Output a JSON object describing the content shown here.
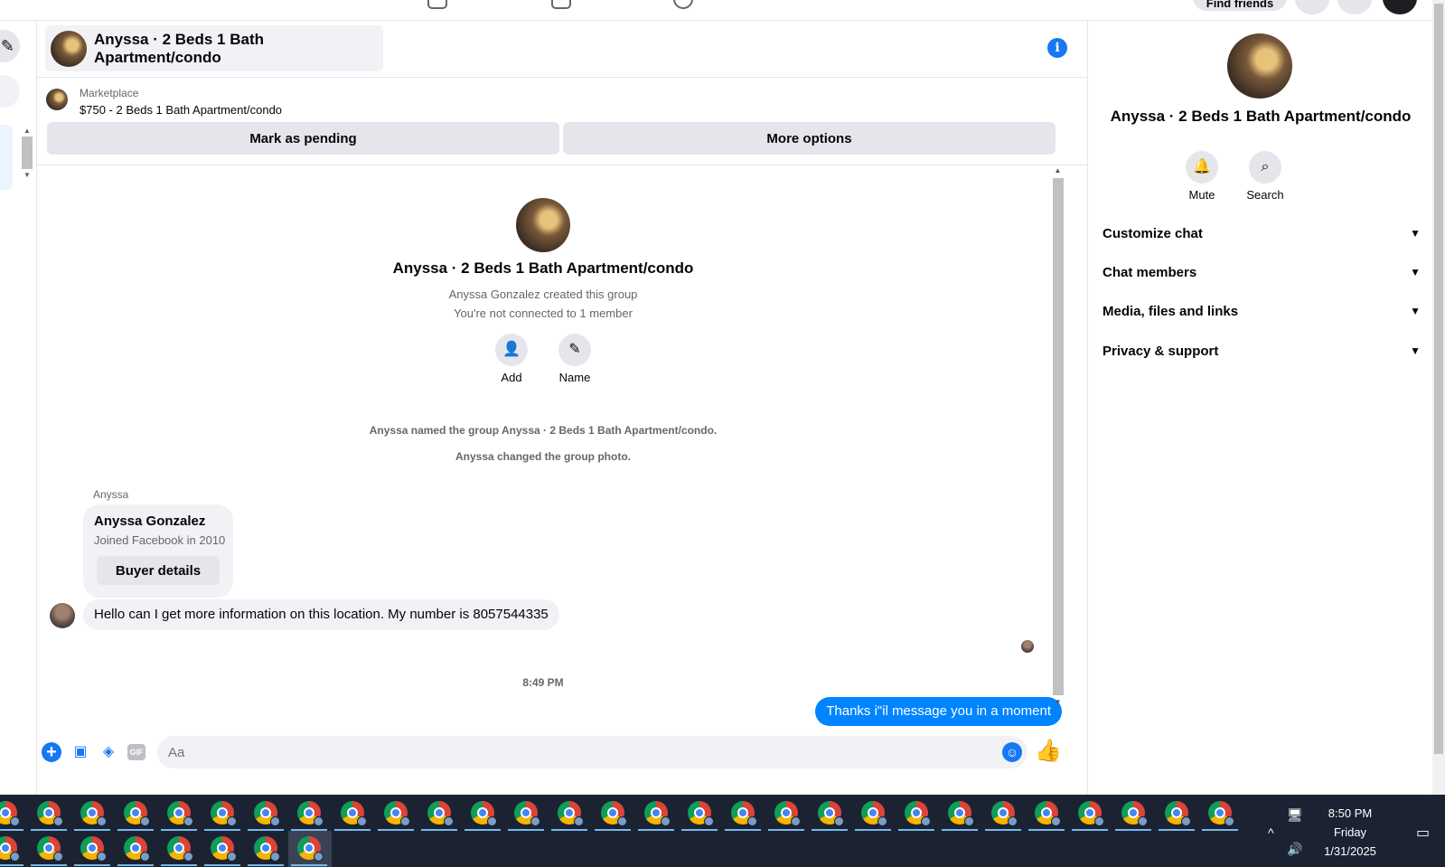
{
  "topbar": {
    "find_friends": "Find friends"
  },
  "chat": {
    "title": "Anyssa · 2 Beds 1 Bath Apartment/condo",
    "marketplace": {
      "label": "Marketplace",
      "listing": "$750 - 2 Beds 1 Bath Apartment/condo",
      "mark_pending": "Mark as pending",
      "more_options": "More options"
    },
    "intro": {
      "title": "Anyssa · 2 Beds 1 Bath Apartment/condo",
      "created": "Anyssa Gonzalez created this group",
      "connected": "You're not connected to 1 member",
      "add_label": "Add",
      "name_label": "Name"
    },
    "system_messages": [
      "Anyssa named the group Anyssa · 2 Beds 1 Bath Apartment/condo.",
      "Anyssa changed the group photo."
    ],
    "sender": "Anyssa",
    "profile_card": {
      "name": "Anyssa Gonzalez",
      "joined": "Joined Facebook in 2010",
      "button": "Buyer details"
    },
    "incoming_message": "Hello can I get more information on this location. My number is 8057544335",
    "timestamp": "8:49 PM",
    "outgoing_message": "Thanks i\"il message you in a moment",
    "composer": {
      "placeholder": "Aa",
      "gif": "GIF"
    }
  },
  "right_panel": {
    "title": "Anyssa · 2 Beds 1 Bath Apartment/condo",
    "mute_label": "Mute",
    "search_label": "Search",
    "sections": [
      "Customize chat",
      "Chat members",
      "Media, files and links",
      "Privacy & support"
    ]
  },
  "taskbar": {
    "time": "8:50 PM",
    "day": "Friday",
    "date": "1/31/2025"
  },
  "colors": {
    "accent": "#1877f2",
    "outgoing_bubble": "#0084ff",
    "bubble_gray": "#f0f2f5",
    "button_gray": "#e4e6eb",
    "taskbar": "#1b2332"
  }
}
